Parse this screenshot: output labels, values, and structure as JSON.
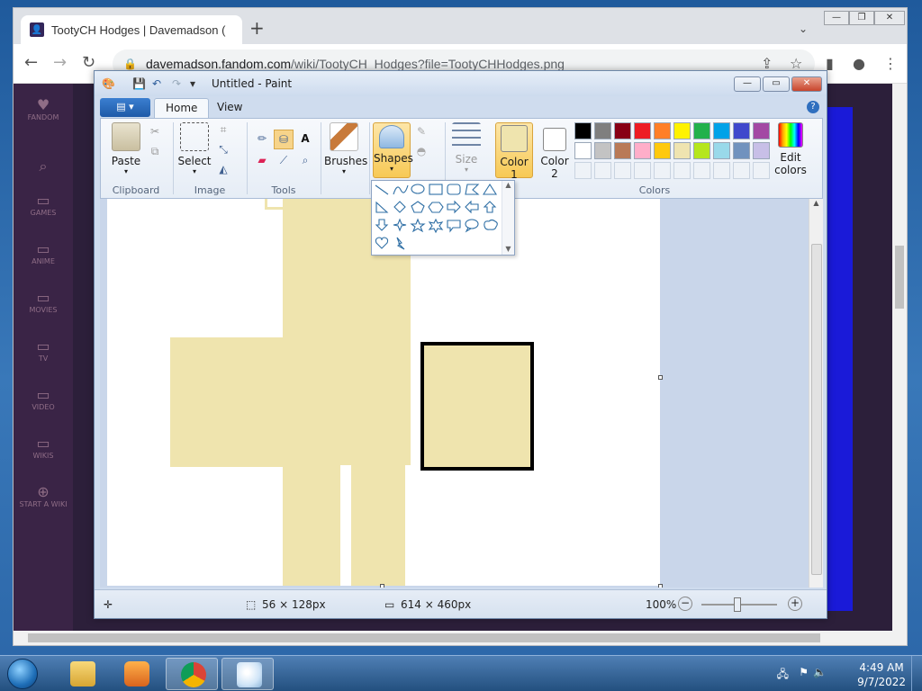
{
  "browser": {
    "tab_title": "TootyCH Hodges | Davemadson (",
    "url_host": "davemadson.fandom.com",
    "url_path": "/wiki/TootyCH_Hodges?file=TootyCHHodges.png",
    "win_minimize": "—",
    "win_restore": "❐",
    "win_close": "✕",
    "new_tab": "+"
  },
  "fandom_rail": [
    {
      "icon": "fandom-logo-icon",
      "label": "FANDOM"
    },
    {
      "icon": "search-icon",
      "label": ""
    },
    {
      "icon": "games-icon",
      "label": "GAMES"
    },
    {
      "icon": "anime-icon",
      "label": "ANIME"
    },
    {
      "icon": "movies-icon",
      "label": "MOVIES"
    },
    {
      "icon": "tv-icon",
      "label": "TV"
    },
    {
      "icon": "video-icon",
      "label": "VIDEO"
    },
    {
      "icon": "wikis-icon",
      "label": "WIKIS"
    },
    {
      "icon": "start-a-wiki-icon",
      "label": "START A WIKI"
    }
  ],
  "paint": {
    "title": "Untitled - Paint",
    "tabs": {
      "home": "Home",
      "view": "View"
    },
    "groups": {
      "clipboard": "Clipboard",
      "image": "Image",
      "tools": "Tools",
      "colors": "Colors"
    },
    "buttons": {
      "paste": "Paste",
      "select": "Select",
      "brushes": "Brushes",
      "shapes": "Shapes",
      "size": "Size",
      "color1_line1": "Color",
      "color1_line2": "1",
      "color2_line1": "Color",
      "color2_line2": "2",
      "edit_colors_line1": "Edit",
      "edit_colors_line2": "colors"
    },
    "color1": "#efe4ae",
    "color2": "#ffffff",
    "palette_row1": [
      "#000000",
      "#7f7f7f",
      "#880015",
      "#ed1c24",
      "#ff7f27",
      "#fff200",
      "#22b14c",
      "#00a2e8",
      "#3f48cc",
      "#a349a4"
    ],
    "palette_row2": [
      "#ffffff",
      "#c3c3c3",
      "#b97a57",
      "#ffaec9",
      "#ffc90e",
      "#efe4b0",
      "#b5e61d",
      "#99d9ea",
      "#7092be",
      "#c8bfe7"
    ],
    "status": {
      "selection_size": "56 × 128px",
      "canvas_size": "614 × 460px",
      "zoom": "100%"
    }
  },
  "taskbar": {
    "apps": [
      "explorer-icon",
      "media-player-icon",
      "chrome-icon",
      "paint-icon"
    ],
    "time": "4:49 AM",
    "date": "9/7/2022"
  }
}
